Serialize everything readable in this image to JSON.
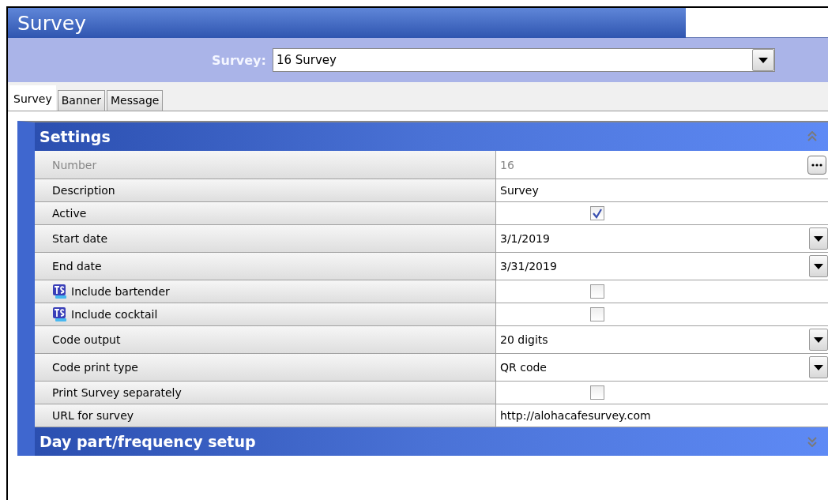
{
  "window": {
    "title": "Survey"
  },
  "selector": {
    "label": "Survey:",
    "value": "16 Survey"
  },
  "tabs": [
    {
      "label": "Survey",
      "selected": true
    },
    {
      "label": "Banner",
      "selected": false
    },
    {
      "label": "Message",
      "selected": false
    }
  ],
  "sections": [
    {
      "title": "Settings",
      "expanded": true,
      "rows": [
        {
          "label": "Number",
          "kind": "ellipsis",
          "value": "16",
          "disabled": true,
          "ts_icon": false
        },
        {
          "label": "Description",
          "kind": "text",
          "value": "Survey",
          "disabled": false,
          "ts_icon": false
        },
        {
          "label": "Active",
          "kind": "check",
          "checked": true,
          "disabled": false,
          "ts_icon": false
        },
        {
          "label": "Start date",
          "kind": "dropdown",
          "value": "3/1/2019",
          "disabled": false,
          "ts_icon": false
        },
        {
          "label": "End date",
          "kind": "dropdown",
          "value": "3/31/2019",
          "disabled": false,
          "ts_icon": false
        },
        {
          "label": "Include bartender",
          "kind": "check",
          "checked": false,
          "disabled": false,
          "ts_icon": true
        },
        {
          "label": "Include cocktail",
          "kind": "check",
          "checked": false,
          "disabled": false,
          "ts_icon": true
        },
        {
          "label": "Code output",
          "kind": "dropdown",
          "value": "20 digits",
          "disabled": false,
          "ts_icon": false
        },
        {
          "label": "Code print type",
          "kind": "dropdown",
          "value": "QR code",
          "disabled": false,
          "ts_icon": false
        },
        {
          "label": "Print Survey separately",
          "kind": "check",
          "checked": false,
          "disabled": false,
          "ts_icon": false
        },
        {
          "label": "URL for survey",
          "kind": "text",
          "value": "http://alohacafesurvey.com",
          "disabled": false,
          "ts_icon": false
        }
      ]
    },
    {
      "title": "Day part/frequency setup",
      "expanded": false
    }
  ]
}
